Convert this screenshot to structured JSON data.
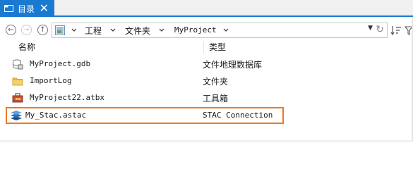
{
  "tab": {
    "label": "目录",
    "close": "✕"
  },
  "nav": {
    "back": "←",
    "forward": "→",
    "up": "↑"
  },
  "breadcrumb": {
    "items": [
      "工程",
      "文件夹",
      "MyProject"
    ],
    "chevron": "›",
    "dropdown": "▼",
    "refresh": "↻"
  },
  "columns": {
    "name": "名称",
    "type": "类型"
  },
  "rows": [
    {
      "name": "MyProject.gdb",
      "type": "文件地理数据库",
      "icon": "geodatabase-icon"
    },
    {
      "name": "ImportLog",
      "type": "文件夹",
      "icon": "folder-icon"
    },
    {
      "name": "MyProject22.atbx",
      "type": "工具箱",
      "icon": "toolbox-icon"
    },
    {
      "name": "My_Stac.astac",
      "type": "STAC Connection",
      "icon": "stac-layers-icon"
    }
  ],
  "colors": {
    "accent": "#1a7ad0",
    "highlight": "#e87b2a",
    "folder": "#f3c553",
    "toolbox": "#c4503a",
    "stac": "#2f6fb6"
  }
}
